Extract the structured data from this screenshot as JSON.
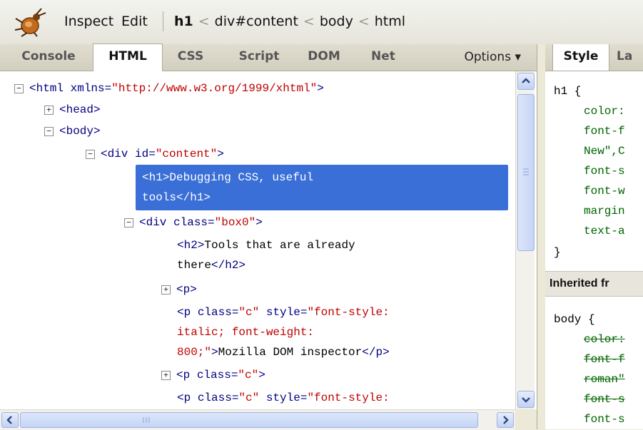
{
  "toolbar": {
    "inspect": "Inspect",
    "edit": "Edit",
    "breadcrumbs": [
      "h1",
      "div#content",
      "body",
      "html"
    ]
  },
  "left_tabs": [
    "Console",
    "HTML",
    "CSS",
    "Script",
    "DOM",
    "Net"
  ],
  "options_label": "Options ▾",
  "right_tabs": [
    "Style",
    "La"
  ],
  "tree": {
    "html_open": "<html",
    "html_attr": "xmlns=",
    "html_val": "\"http://www.w3.org/1999/xhtml\"",
    "html_close": ">",
    "head": "<head>",
    "body": "<body>",
    "div_open": "<div",
    "div_attr": "id=",
    "div_val": "\"content\"",
    "gt": ">",
    "h1_open": "<h1>",
    "h1_text_1": "Debugging CSS, useful",
    "h1_text_2": "tools",
    "h1_close": "</h1>",
    "box_attr": "class=",
    "box_val": "\"box0\"",
    "h2_open": "<h2>",
    "h2_text_1": "Tools that are already",
    "h2_text_2": "there",
    "h2_close": "</h2>",
    "p": "<p>",
    "p_open": "<p",
    "class_attr": "class=",
    "c_val": "\"c\"",
    "style_attr": "style=",
    "style_val_1": "\"font-style:",
    "style_val_2": "italic; font-weight:",
    "style_val_3": "800;\"",
    "p_text": "Mozilla DOM inspector",
    "p_close": "</p>",
    "style_val_last": "\"font-style:"
  },
  "styles": {
    "selector": "h1 {",
    "props": [
      "color:",
      "font-f",
      "New\",C",
      "font-s",
      "font-w",
      "margin",
      "text-a"
    ],
    "close": "}",
    "inherited_label": "Inherited fr",
    "body_selector": "body {",
    "body_props": [
      "color:",
      "font-f",
      "roman\"",
      "font-s",
      "font-s"
    ]
  },
  "colors": {
    "selection": "#3a6fd8",
    "tag": "#000080",
    "value": "#c00000",
    "prop": "#006400"
  },
  "icons": [
    "firebug-bug-icon",
    "expand-icon",
    "collapse-icon",
    "scroll-up-icon",
    "scroll-down-icon",
    "scroll-left-icon",
    "scroll-right-icon"
  ]
}
